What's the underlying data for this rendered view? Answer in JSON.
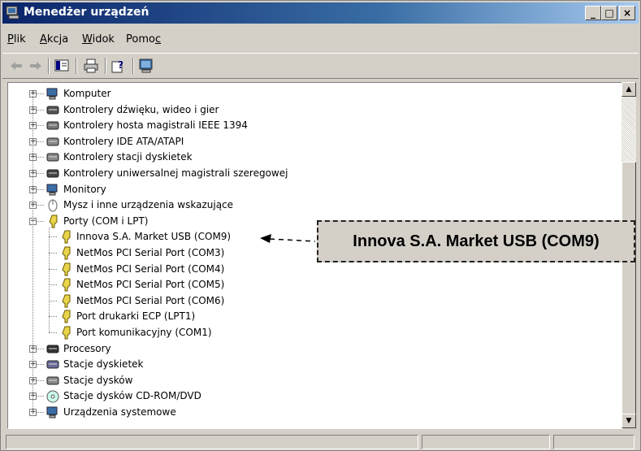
{
  "window": {
    "title": "Menedżer urządzeń"
  },
  "titlebar_buttons": {
    "minimize": "_",
    "maximize": "□",
    "close": "×"
  },
  "menu": [
    {
      "label_pre": "",
      "label_u": "P",
      "label_post": "lik"
    },
    {
      "label_pre": "",
      "label_u": "A",
      "label_post": "kcja"
    },
    {
      "label_pre": "",
      "label_u": "W",
      "label_post": "idok"
    },
    {
      "label_pre": "Pomo",
      "label_u": "c",
      "label_post": ""
    }
  ],
  "tree": {
    "items": [
      {
        "label": "Komputer",
        "icon": "computer-icon"
      },
      {
        "label": "Kontrolery dźwięku, wideo i gier",
        "icon": "sound-icon"
      },
      {
        "label": "Kontrolery hosta magistrali IEEE 1394",
        "icon": "ieee1394-icon"
      },
      {
        "label": "Kontrolery IDE ATA/ATAPI",
        "icon": "ide-controller-icon"
      },
      {
        "label": "Kontrolery stacji dyskietek",
        "icon": "floppy-controller-icon"
      },
      {
        "label": "Kontrolery uniwersalnej magistrali szeregowej",
        "icon": "usb-icon"
      },
      {
        "label": "Monitory",
        "icon": "monitor-icon"
      },
      {
        "label": "Mysz i inne urządzenia wskazujące",
        "icon": "mouse-icon"
      },
      {
        "label": "Porty (COM i LPT)",
        "icon": "port-icon"
      },
      {
        "label": "Innova S.A. Market USB (COM9)",
        "icon": "port-icon"
      },
      {
        "label": "NetMos PCI Serial Port (COM3)",
        "icon": "port-icon"
      },
      {
        "label": "NetMos PCI Serial Port (COM4)",
        "icon": "port-icon"
      },
      {
        "label": "NetMos PCI Serial Port (COM5)",
        "icon": "port-icon"
      },
      {
        "label": "NetMos PCI Serial Port (COM6)",
        "icon": "port-icon"
      },
      {
        "label": "Port drukarki ECP (LPT1)",
        "icon": "port-icon"
      },
      {
        "label": "Port komunikacyjny (COM1)",
        "icon": "port-icon"
      },
      {
        "label": "Procesory",
        "icon": "processor-icon"
      },
      {
        "label": "Stacje dyskietek",
        "icon": "floppy-drive-icon"
      },
      {
        "label": "Stacje dysków",
        "icon": "disk-drive-icon"
      },
      {
        "label": "Stacje dysków CD-ROM/DVD",
        "icon": "cdrom-icon"
      },
      {
        "label": "Urządzenia systemowe",
        "icon": "system-device-icon"
      }
    ]
  },
  "callout": {
    "text": "Innova S.A. Market USB (COM9)"
  },
  "colors": {
    "titlebar_start": "#0a246a",
    "titlebar_end": "#a6caf0",
    "face": "#d4d0c8"
  }
}
